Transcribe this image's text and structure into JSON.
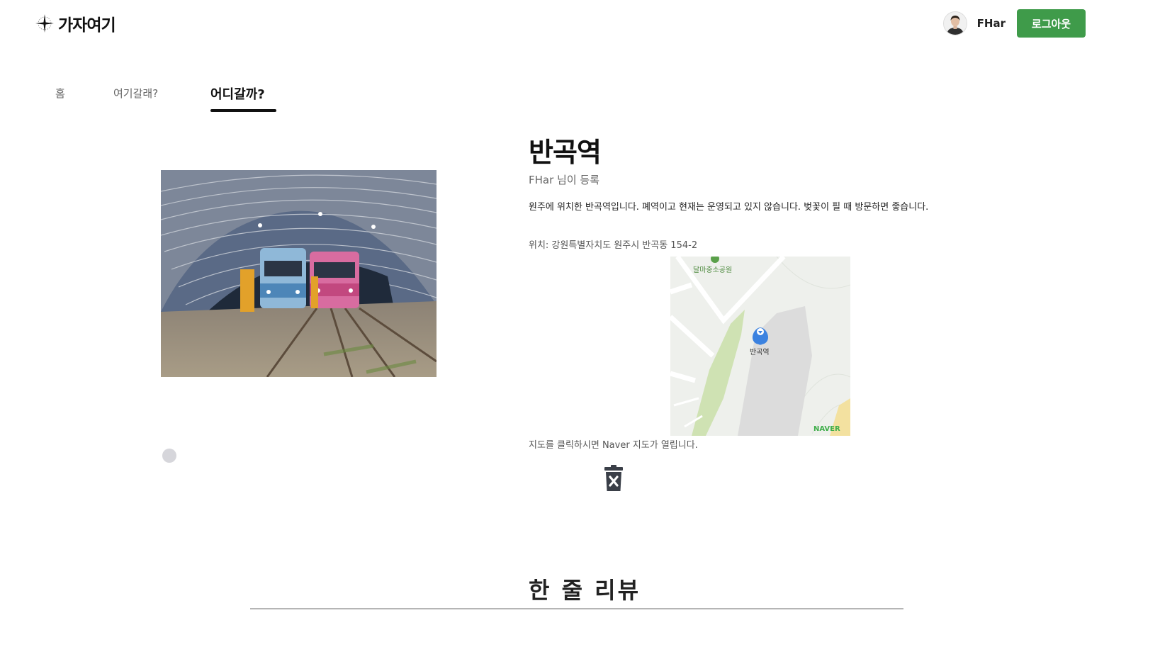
{
  "header": {
    "logo_text": "가자여기",
    "username": "FHar",
    "logout_label": "로그아웃"
  },
  "nav": {
    "items": [
      {
        "label": "홈"
      },
      {
        "label": "여기갈래?"
      },
      {
        "label": "어디갈까?"
      }
    ],
    "active_index": 2
  },
  "place": {
    "title": "반곡역",
    "author": "FHar 님이 등록",
    "description": "원주에 위치한 반곡역입니다. 폐역이고 현재는 운영되고 있지 않습니다. 벚꽃이 필 때 방문하면 좋습니다.",
    "location": "위치: 강원특별자치도 원주시 반곡동 154-2",
    "map_hint": "지도를 클릭하시면 Naver 지도가 열립니다.",
    "map": {
      "park_label": "달마중소공원",
      "marker_label": "반곡역",
      "provider_logo": "NAVER"
    },
    "carousel_count": 1,
    "carousel_active": 0
  },
  "reviews": {
    "title": "한 줄 리뷰"
  },
  "colors": {
    "primary_green": "#3f9b4a",
    "nav_active": "#111111",
    "map_pin": "#3b82e0"
  },
  "icons": [
    "compass-icon",
    "avatar",
    "trash-x-icon",
    "map-pin-icon"
  ]
}
